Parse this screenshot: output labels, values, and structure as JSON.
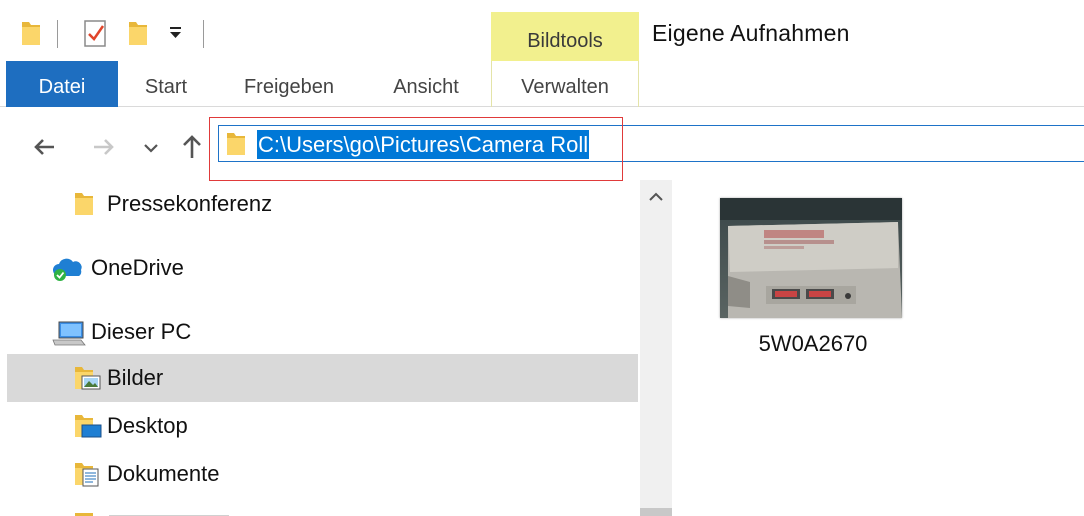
{
  "window": {
    "title": "Eigene Aufnahmen"
  },
  "quick_access": {
    "icons": [
      "folder-icon",
      "properties-check-icon",
      "new-folder-icon",
      "customize-dropdown-icon"
    ]
  },
  "ribbon": {
    "context_group": "Bildtools",
    "tabs": [
      {
        "label": "Datei",
        "active": true
      },
      {
        "label": "Start"
      },
      {
        "label": "Freigeben"
      },
      {
        "label": "Ansicht"
      },
      {
        "label": "Verwalten"
      }
    ]
  },
  "navigation": {
    "icons": [
      "back-arrow-icon",
      "forward-arrow-icon",
      "recent-locations-chevron-icon",
      "up-arrow-icon"
    ],
    "address": "C:\\Users\\go\\Pictures\\Camera Roll"
  },
  "tree": [
    {
      "label": "Pressekonferenz",
      "icon": "folder-icon"
    },
    {
      "label": "OneDrive",
      "icon": "onedrive-cloud-icon"
    },
    {
      "label": "Dieser PC",
      "icon": "computer-icon"
    },
    {
      "label": "Bilder",
      "icon": "pictures-folder-icon",
      "selected": true
    },
    {
      "label": "Desktop",
      "icon": "desktop-folder-icon"
    },
    {
      "label": "Dokumente",
      "icon": "documents-folder-icon"
    }
  ],
  "files": [
    {
      "name": "5W0A2670",
      "kind": "image-thumbnail"
    }
  ],
  "colors": {
    "accent": "#1e6ec0",
    "selection": "#0078d7",
    "context_tab": "#f2f08e",
    "selected_row": "#d9d9d9",
    "highlight_box": "#e03a3a"
  }
}
